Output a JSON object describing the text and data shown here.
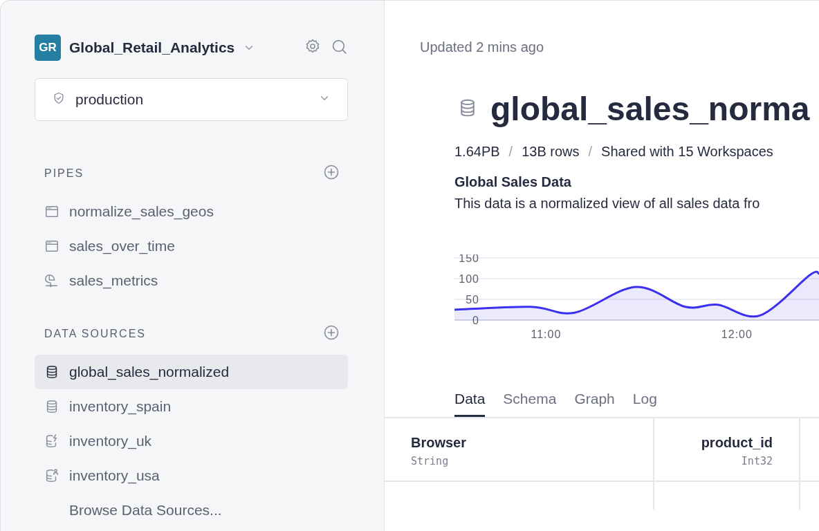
{
  "workspace": {
    "initials": "GR",
    "name": "Global_Retail_Analytics"
  },
  "environment": {
    "value": "production"
  },
  "sections": [
    {
      "title": "PIPES",
      "items": [
        {
          "label": "normalize_sales_geos",
          "kind": "window",
          "selected": false
        },
        {
          "label": "sales_over_time",
          "kind": "window",
          "selected": false
        },
        {
          "label": "sales_metrics",
          "kind": "stand",
          "selected": false
        }
      ]
    },
    {
      "title": "DATA SOURCES",
      "items": [
        {
          "label": "global_sales_normalized",
          "kind": "database",
          "selected": true
        },
        {
          "label": "inventory_spain",
          "kind": "database",
          "selected": false
        },
        {
          "label": "inventory_uk",
          "kind": "database-bolt",
          "selected": false
        },
        {
          "label": "inventory_usa",
          "kind": "database-user",
          "selected": false
        }
      ],
      "footer_link": "Browse Data Sources..."
    }
  ],
  "main": {
    "updated": "Updated 2 mins ago",
    "title": "global_sales_norma",
    "stats": [
      "1.64PB",
      "13B rows",
      "Shared with 15 Workspaces"
    ],
    "stats_separator": "/",
    "description_title": "Global Sales Data",
    "description": "This data is a normalized view of all sales data fro",
    "chart_data": {
      "type": "area",
      "x": [
        10.52,
        10.92,
        11.15,
        11.47,
        11.73,
        11.9,
        12.12,
        12.38,
        12.43
      ],
      "series": [
        {
          "color": "#3b2ff0",
          "values": [
            25,
            32,
            18,
            80,
            32,
            37,
            11,
            108,
            112
          ]
        }
      ],
      "xlim": [
        10.52,
        12.43
      ],
      "ylim": [
        0,
        150
      ],
      "xticks": [
        {
          "value": 11,
          "label": "11:00"
        },
        {
          "value": 12,
          "label": "12:00"
        }
      ],
      "yticks": [
        0,
        50,
        100,
        150
      ]
    },
    "tabs": [
      {
        "label": "Data",
        "selected": true
      },
      {
        "label": "Schema",
        "selected": false
      },
      {
        "label": "Graph",
        "selected": false
      },
      {
        "label": "Log",
        "selected": false
      }
    ],
    "table": {
      "columns": [
        {
          "name": "Browser",
          "type": "String"
        },
        {
          "name": "product_id",
          "type": "Int32"
        }
      ]
    }
  }
}
